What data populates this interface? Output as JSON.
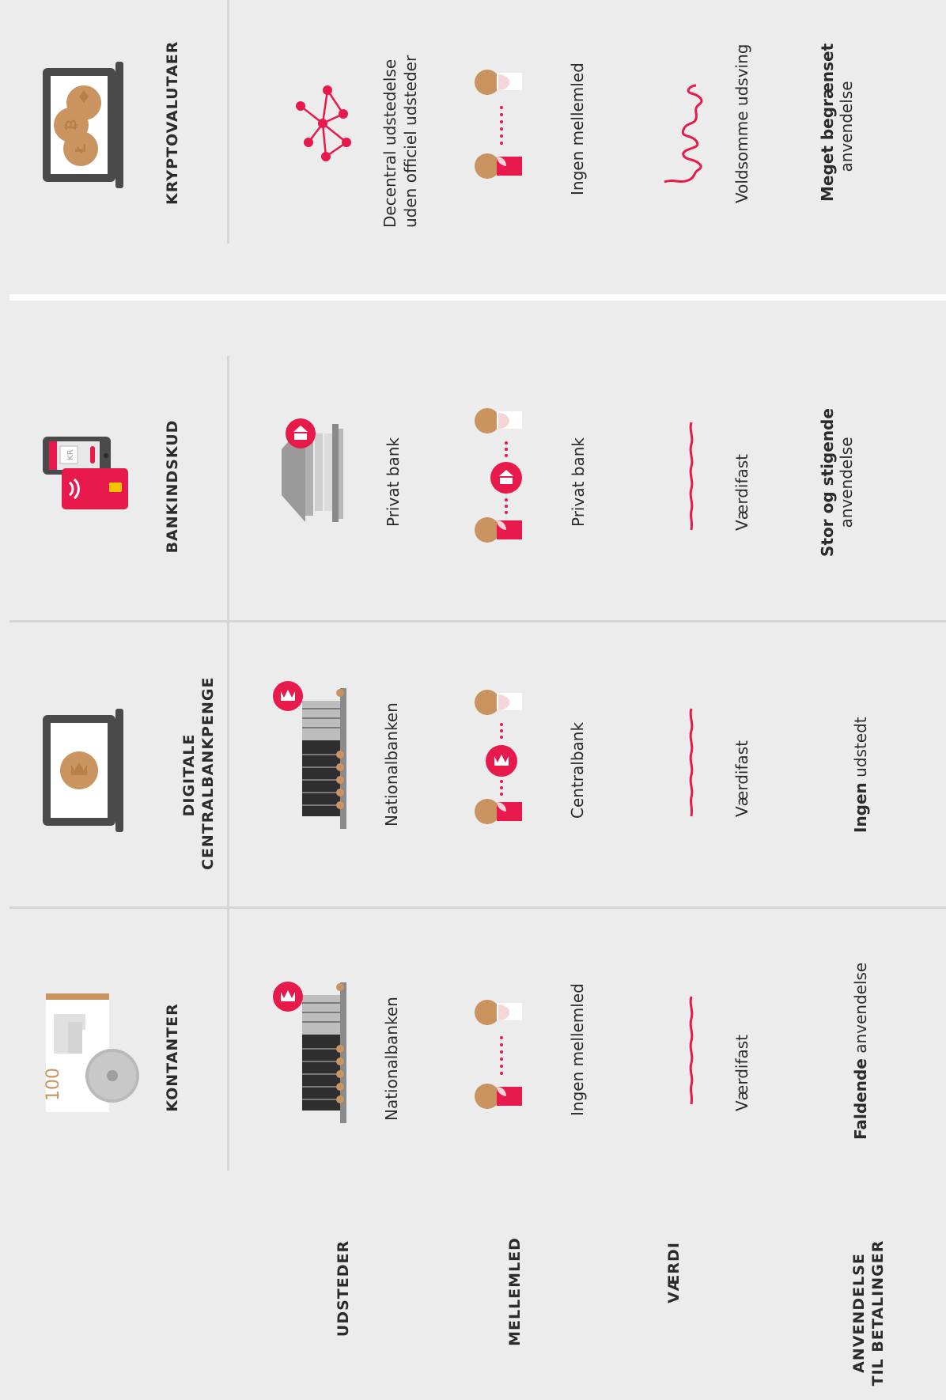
{
  "row_labels": {
    "udsteder": "UDSTEDER",
    "mellemled": "MELLEMLED",
    "vaerdi": "VÆRDI",
    "anvendelse_1": "ANVENDELSE",
    "anvendelse_2": "TIL BETALINGER"
  },
  "columns": [
    {
      "title_1": "KONTANTER",
      "title_2": "",
      "issuer": "Nationalbanken",
      "intermediary": "Ingen mellemled",
      "value": "Værdifast",
      "usage_bold": "Faldende",
      "usage_rest": " anvendelse",
      "banknote_value": "100"
    },
    {
      "title_1": "DIGITALE",
      "title_2": "CENTRALBANKPENGE",
      "issuer": "Nationalbanken",
      "intermediary": "Centralbank",
      "value": "Værdifast",
      "usage_bold": "Ingen",
      "usage_rest": " udstedt"
    },
    {
      "title_1": "BANKINDSKUD",
      "title_2": "",
      "issuer": "Privat bank",
      "intermediary": "Privat bank",
      "value": "Værdifast",
      "usage_bold": "Stor og stigende",
      "usage_rest": "anvendelse",
      "phone_text": "KR"
    },
    {
      "title_1": "KRYPTOVALUTAER",
      "title_2": "",
      "issuer_1": "Decentral udstedelse",
      "issuer_2": "uden officiel udsteder",
      "intermediary": "Ingen mellemled",
      "value": "Voldsomme udsving",
      "usage_bold": "Meget begrænset",
      "usage_rest": "anvendelse"
    }
  ],
  "colors": {
    "background": "#ececec",
    "accent": "#e8194b",
    "coin": "#c9945f",
    "dark": "#2b2b2b",
    "grid": "#d6d6d6"
  }
}
